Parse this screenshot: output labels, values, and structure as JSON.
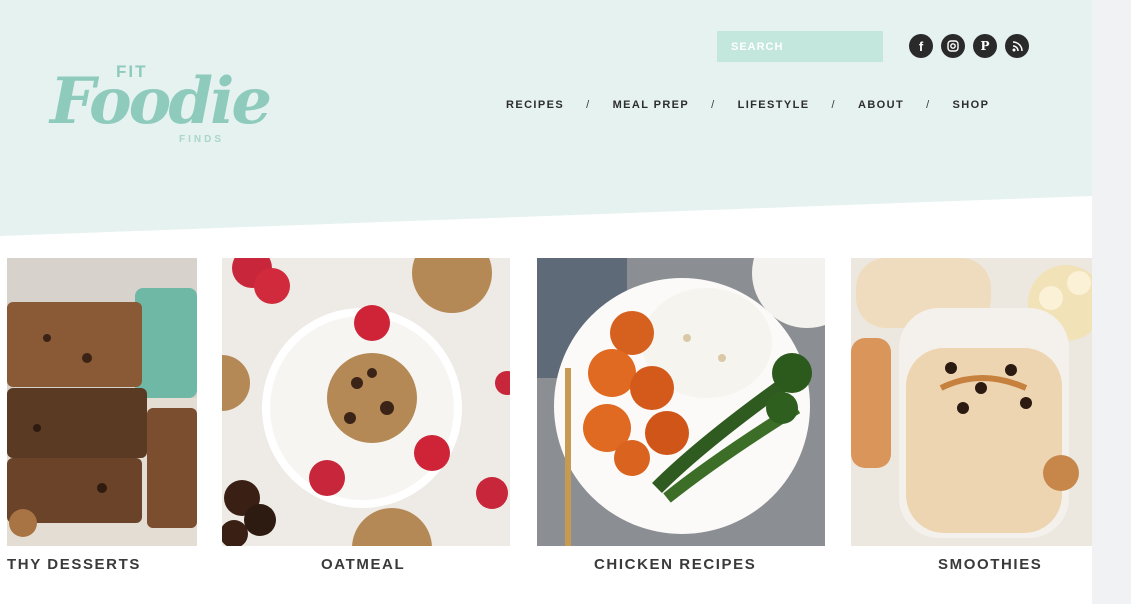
{
  "logo": {
    "fit": "FIT",
    "foodie": "Foodie",
    "finds": "FINDS"
  },
  "search": {
    "placeholder": "SEARCH"
  },
  "social": [
    {
      "icon": "facebook-icon",
      "glyph": "f"
    },
    {
      "icon": "instagram-icon"
    },
    {
      "icon": "pinterest-icon",
      "glyph": "P"
    },
    {
      "icon": "rss-icon"
    }
  ],
  "nav": {
    "items": [
      "RECIPES",
      "MEAL PREP",
      "LIFESTYLE",
      "ABOUT",
      "SHOP"
    ],
    "separator": "/"
  },
  "categories": [
    {
      "label": "THY DESSERTS"
    },
    {
      "label": "OATMEAL"
    },
    {
      "label": "CHICKEN RECIPES"
    },
    {
      "label": "SMOOTHIES"
    }
  ],
  "colors": {
    "header_bg": "#e5f2f0",
    "brand_mint": "#8fcbbd",
    "search_bg": "#c3e6dd",
    "text_dark": "#2d2d2d"
  }
}
